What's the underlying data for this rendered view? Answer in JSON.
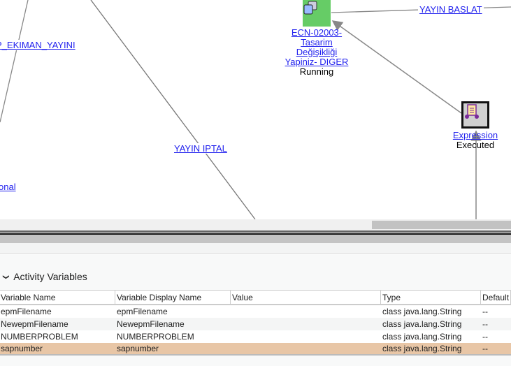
{
  "diagram": {
    "links": [
      "P_EKIMAN_YAYINI",
      "YAYIN IPTAL",
      "onal",
      "YAYIN BASLAT"
    ],
    "nodes": [
      {
        "name": "ECN-02003-Tasarim Değişikliği Yapiniz- DIGER",
        "name_lines": [
          "ECN-02003-",
          "Tasarim",
          "Değişikliği",
          "Yapiniz- DIGER"
        ],
        "status": "Running",
        "icon": "task-icon",
        "color": "#66cc66"
      },
      {
        "name": "Expression",
        "status": "Executed",
        "icon": "expression-icon"
      }
    ]
  },
  "panel": {
    "section_title": "Activity Variables",
    "columns": [
      "Variable Name",
      "Variable Display Name",
      "Value",
      "Type",
      "Default"
    ],
    "rows": [
      {
        "name": "epmFilename",
        "display": "epmFilename",
        "value": "",
        "type": "class java.lang.String",
        "default": "--"
      },
      {
        "name": "NewepmFilename",
        "display": "NewepmFilename",
        "value": "",
        "type": "class java.lang.String",
        "default": "--"
      },
      {
        "name": "NUMBERPROBLEM",
        "display": "NUMBERPROBLEM",
        "value": "",
        "type": "class java.lang.String",
        "default": "--"
      },
      {
        "name": "sapnumber",
        "display": "sapnumber",
        "value": "",
        "type": "class java.lang.String",
        "default": "--"
      }
    ]
  }
}
